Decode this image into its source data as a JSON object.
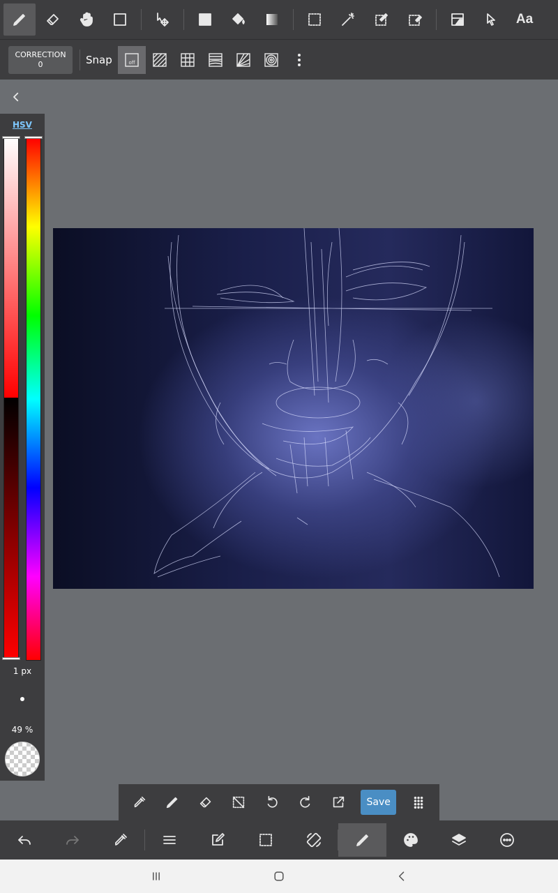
{
  "toolbar_top": {
    "tools": [
      "pen-icon",
      "eraser-icon",
      "hand-icon",
      "rectangle-icon",
      "move-icon",
      "fill-rect-icon",
      "bucket-icon",
      "gradient-icon",
      "select-rect-icon",
      "magic-wand-icon",
      "select-pen-icon",
      "select-eraser-icon",
      "layer-panel-icon",
      "cursor-icon"
    ],
    "text_tool_label": "Aa"
  },
  "toolbar_sub": {
    "correction_label": "CORRECTION",
    "correction_value": "0",
    "snap_label": "Snap",
    "snap_off_label": "off"
  },
  "color_panel": {
    "mode_label": "HSV",
    "brush_size": "1 px",
    "opacity": "49 %",
    "color": "#ff0000"
  },
  "float_toolbar": {
    "save_label": "Save"
  },
  "colors": {
    "panel": "#3d3d3f",
    "workspace": "#6b6e72",
    "save_button": "#4a8ec4",
    "hsv_tab": "#7ec8ff"
  }
}
